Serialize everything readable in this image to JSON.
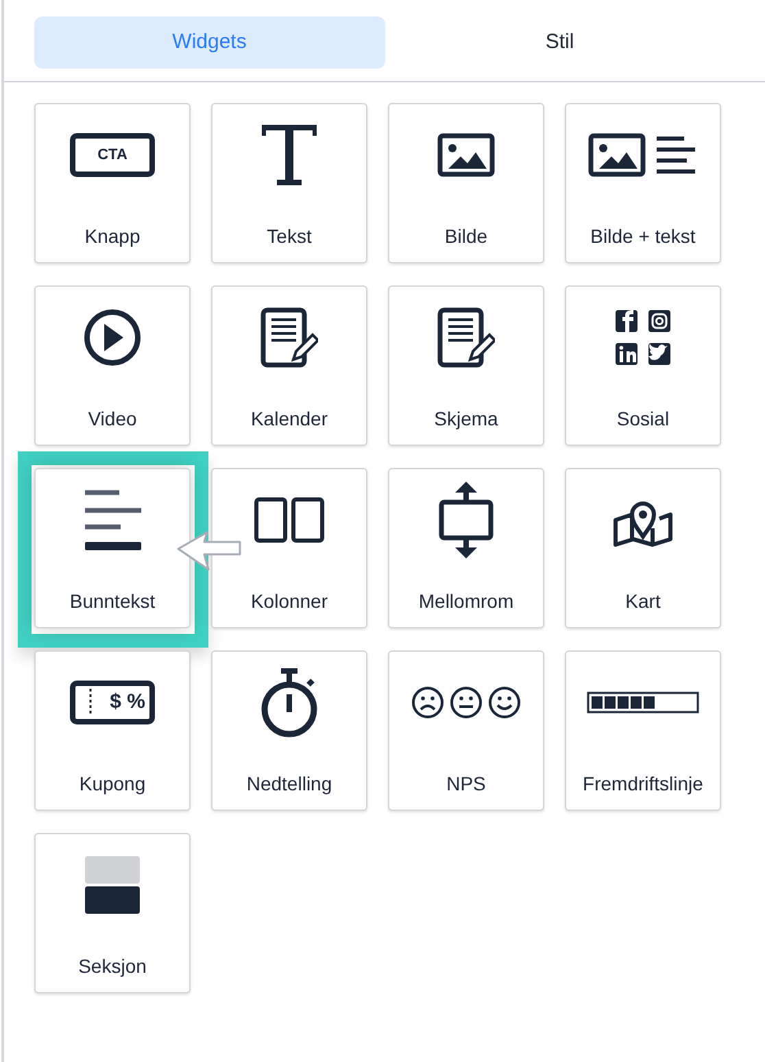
{
  "tabs": [
    {
      "label": "Widgets",
      "selected": true
    },
    {
      "label": "Stil",
      "selected": false
    }
  ],
  "widgets": [
    {
      "label": "Knapp",
      "kind": "button",
      "icon_text": "CTA",
      "highlighted": false
    },
    {
      "label": "Tekst",
      "kind": "text",
      "highlighted": false
    },
    {
      "label": "Bilde",
      "kind": "image",
      "highlighted": false
    },
    {
      "label": "Bilde + tekst",
      "kind": "image-text",
      "highlighted": false
    },
    {
      "label": "Video",
      "kind": "video",
      "highlighted": false
    },
    {
      "label": "Kalender",
      "kind": "calendar",
      "highlighted": false
    },
    {
      "label": "Skjema",
      "kind": "form",
      "highlighted": false
    },
    {
      "label": "Sosial",
      "kind": "social",
      "highlighted": false
    },
    {
      "label": "Bunntekst",
      "kind": "footer",
      "highlighted": true
    },
    {
      "label": "Kolonner",
      "kind": "columns",
      "highlighted": false
    },
    {
      "label": "Mellomrom",
      "kind": "spacer",
      "highlighted": false
    },
    {
      "label": "Kart",
      "kind": "map",
      "highlighted": false
    },
    {
      "label": "Kupong",
      "kind": "coupon",
      "icon_text": "$ %",
      "highlighted": false
    },
    {
      "label": "Nedtelling",
      "kind": "countdown",
      "highlighted": false
    },
    {
      "label": "NPS",
      "kind": "nps",
      "highlighted": false
    },
    {
      "label": "Fremdriftslinje",
      "kind": "progress",
      "highlighted": false
    },
    {
      "label": "Seksjon",
      "kind": "section",
      "highlighted": false
    }
  ]
}
